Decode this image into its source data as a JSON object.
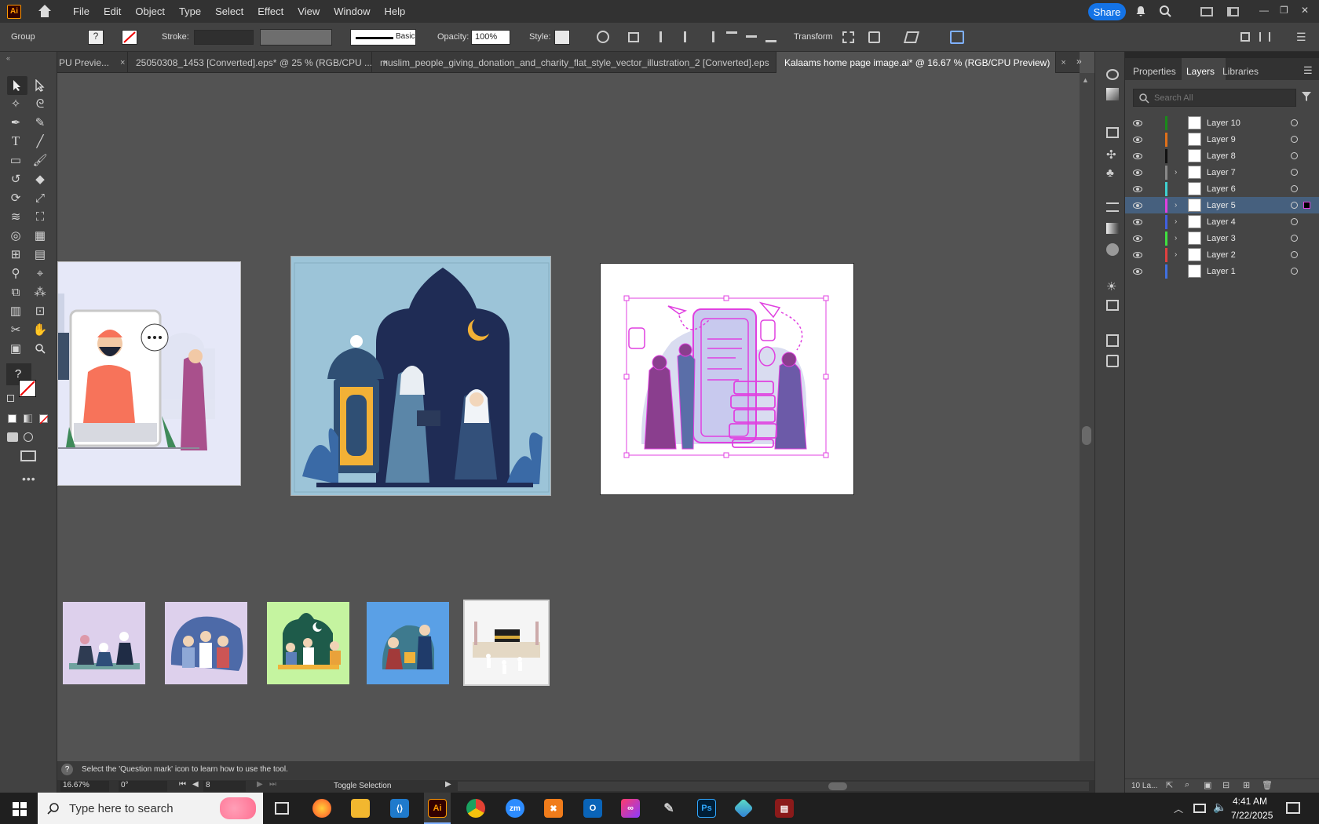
{
  "app": {
    "logo": "Ai",
    "share_label": "Share"
  },
  "menu": [
    "File",
    "Edit",
    "Object",
    "Type",
    "Select",
    "Effect",
    "View",
    "Window",
    "Help"
  ],
  "control": {
    "selection_type": "Group",
    "stroke_label": "Stroke:",
    "brush_label": "Basic",
    "opacity_label": "Opacity:",
    "opacity_value": "100%",
    "style_label": "Style:",
    "transform_label": "Transform"
  },
  "tabs": [
    {
      "label": "PU Previe...",
      "close": "×"
    },
    {
      "label": "25050308_1453 [Converted].eps* @ 25 % (RGB/CPU ...",
      "close": "×"
    },
    {
      "label": "muslim_people_giving_donation_and_charity_flat_style_vector_illustration_2 [Converted].eps",
      "close": "×"
    },
    {
      "label": "Kalaams home page image.ai* @ 16.67 % (RGB/CPU Preview)",
      "close": "×"
    }
  ],
  "panel": {
    "tabs": [
      "Properties",
      "Layers",
      "Libraries"
    ],
    "search_placeholder": "Search All",
    "layers": [
      {
        "name": "Layer 10",
        "color": "#1a8a1a",
        "expandable": false
      },
      {
        "name": "Layer 9",
        "color": "#e0701a",
        "expandable": false
      },
      {
        "name": "Layer 8",
        "color": "#111111",
        "expandable": false
      },
      {
        "name": "Layer 7",
        "color": "#888888",
        "expandable": true
      },
      {
        "name": "Layer 6",
        "color": "#40d0d0",
        "expandable": false
      },
      {
        "name": "Layer 5",
        "color": "#e040e0",
        "expandable": true,
        "selected": true
      },
      {
        "name": "Layer 4",
        "color": "#4060e0",
        "expandable": true
      },
      {
        "name": "Layer 3",
        "color": "#40e040",
        "expandable": true
      },
      {
        "name": "Layer 2",
        "color": "#e04040",
        "expandable": true
      },
      {
        "name": "Layer 1",
        "color": "#4070e0",
        "expandable": false
      }
    ],
    "footer_count": "10 La..."
  },
  "status": {
    "hint": "Select the 'Question mark' icon to learn how to use the tool.",
    "zoom": "16.67%",
    "rotation": "0°",
    "artboard": "8",
    "toggle": "Toggle Selection"
  },
  "taskbar": {
    "search_placeholder": "Type here to search",
    "time": "4:41 AM",
    "date": "7/22/2025"
  },
  "colors": {
    "accent": "#1473e6",
    "selection": "#e040e0"
  }
}
